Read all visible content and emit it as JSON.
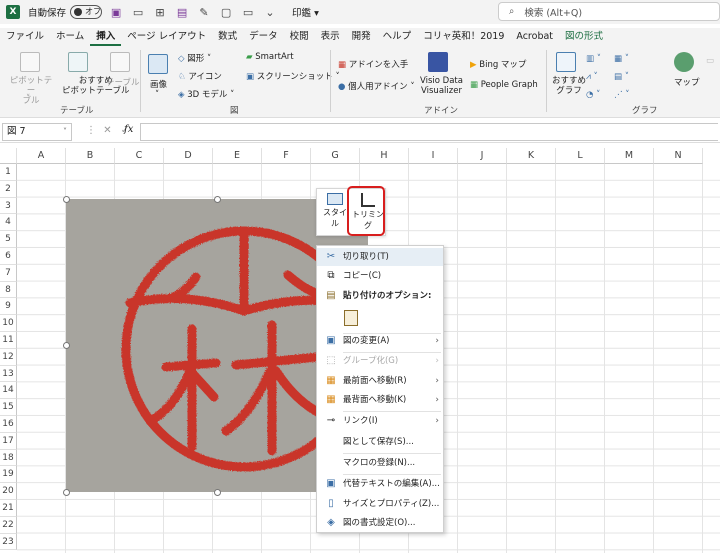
{
  "titlebar": {
    "autosave_label": "自動保存",
    "autosave_state": "オフ",
    "print_label": "印鑑",
    "print_caret": "▾",
    "search_placeholder": "検索 (Alt+Q)"
  },
  "menu_tabs": [
    "ファイル",
    "ホーム",
    "挿入",
    "ページ レイアウト",
    "数式",
    "データ",
    "校閲",
    "表示",
    "開発",
    "ヘルプ",
    "コリャ英和！2019",
    "Acrobat",
    "図の形式"
  ],
  "menu_active": "挿入",
  "ribbon": {
    "pivot_table": "ピボットテー\nブル",
    "pivot_caret": "˅",
    "recommended_pivot_1": "おすすめ",
    "recommended_pivot_2": "ピボットテーブル",
    "table": "テーブル",
    "group_table": "テーブル",
    "images": "画像",
    "images_caret": "˅",
    "shapes": "図形 ˅",
    "icons": "アイコン",
    "models3d": "3D モデル ˅",
    "smartart": "SmartArt",
    "screenshot": "スクリーンショット ˅",
    "group_illust": "図",
    "get_addins": "アドインを入手",
    "my_addins": "個人用アドイン ˅",
    "visio_1": "Visio Data",
    "visio_2": "Visualizer",
    "bing_maps": "Bing マップ",
    "people_graph": "People Graph",
    "group_addins": "アドイン",
    "recommended_charts_1": "おすすめ",
    "recommended_charts_2": "グラフ",
    "maps": "マップ",
    "group_charts": "グラフ"
  },
  "formula_bar": {
    "name_box": "図 7",
    "name_box_caret": "˅",
    "dots": "⋮",
    "cancel": "✕",
    "enter": "✓",
    "fx": "fx",
    "value": ""
  },
  "columns": [
    "A",
    "B",
    "C",
    "D",
    "E",
    "F",
    "G",
    "H",
    "I",
    "J",
    "K",
    "L",
    "M",
    "N"
  ],
  "rows": [
    "1",
    "2",
    "3",
    "4",
    "5",
    "6",
    "7",
    "8",
    "9",
    "10",
    "11",
    "12",
    "13",
    "14",
    "15",
    "16",
    "17",
    "18",
    "19",
    "20",
    "21",
    "22",
    "23"
  ],
  "mini_toolbar": {
    "style_label_1": "スタイ",
    "style_label_2": "ル",
    "trim_label": "トリミング"
  },
  "context_menu": {
    "cut": "切り取り(T)",
    "copy": "コピー(C)",
    "paste_options": "貼り付けのオプション:",
    "change_picture": "図の変更(A)",
    "group": "グループ化(G)",
    "bring_front": "最前面へ移動(R)",
    "send_back": "最背面へ移動(K)",
    "link": "リンク(I)",
    "save_as_picture": "図として保存(S)...",
    "assign_macro": "マクロの登録(N)...",
    "edit_alt_text": "代替テキストの編集(A)...",
    "size_properties": "サイズとプロパティ(Z)...",
    "format_picture": "図の書式設定(O)...",
    "submenu_arrow": "›"
  },
  "colors": {
    "excel_green": "#1d6f42",
    "stamp_red": "#c9362b",
    "highlight_red": "#d81e1e",
    "menu_hover": "#e6eef5"
  }
}
